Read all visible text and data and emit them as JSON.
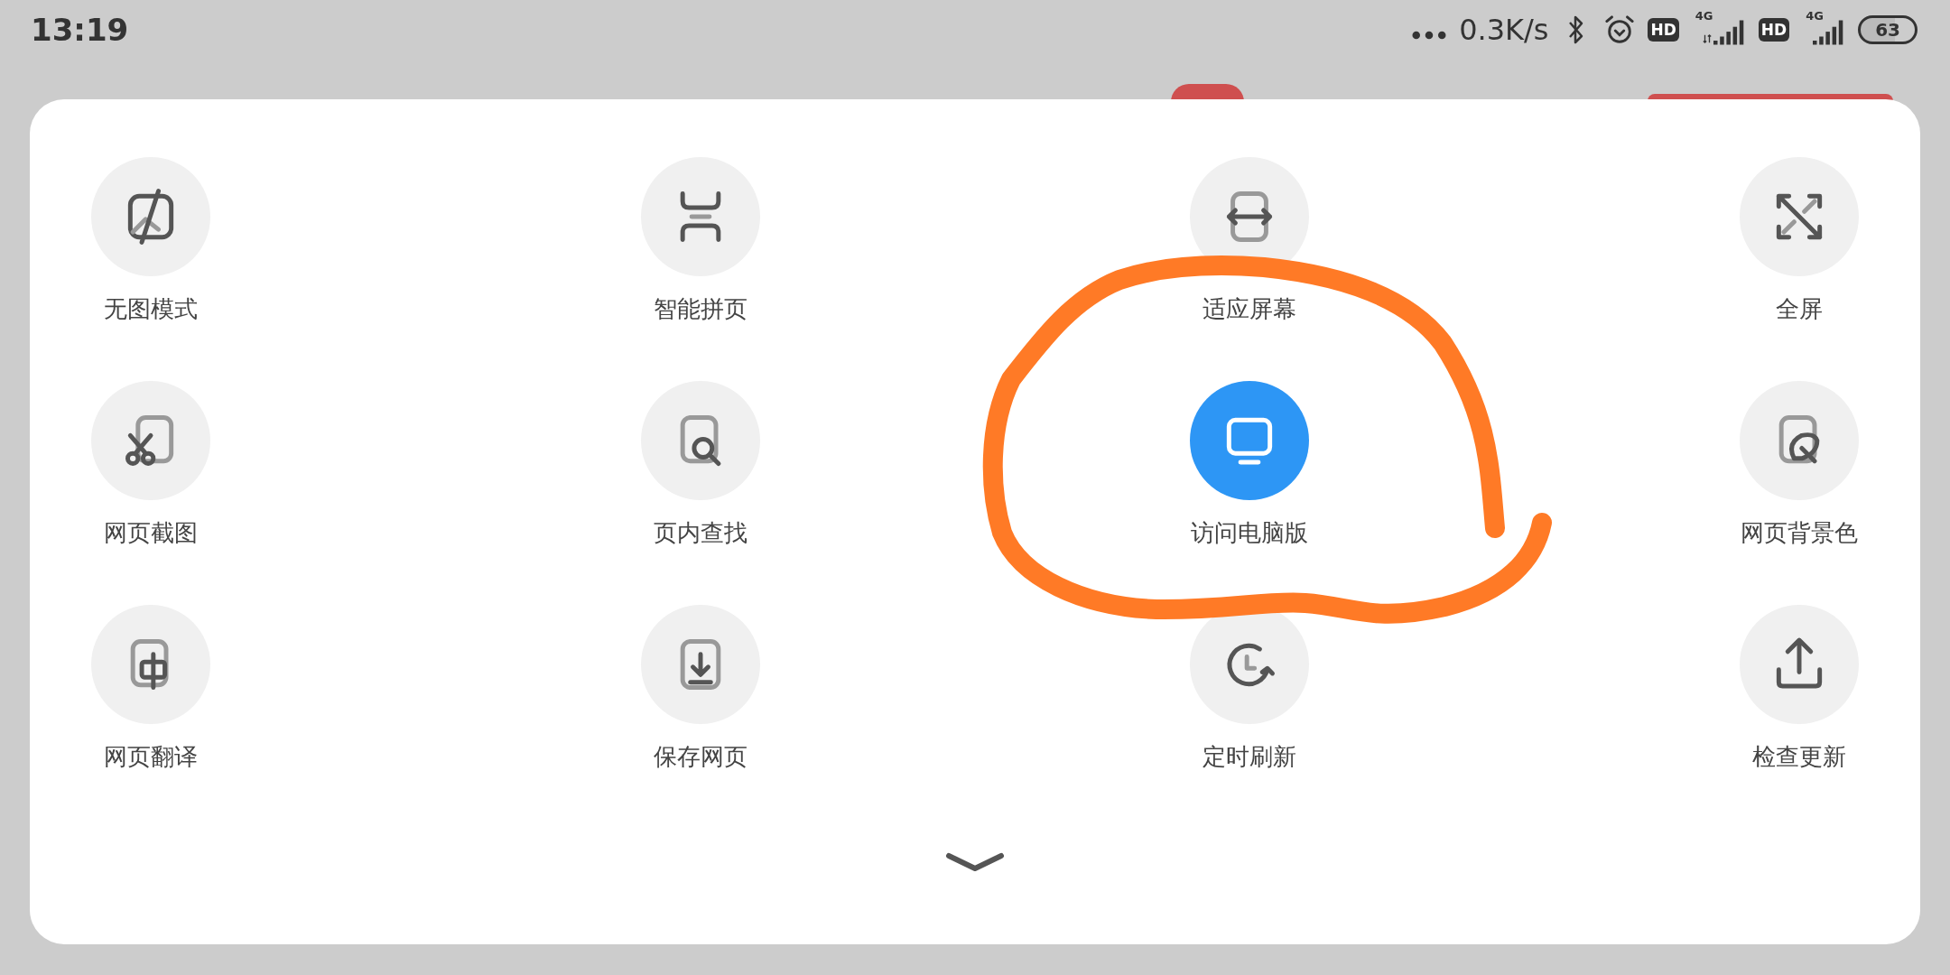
{
  "status_bar": {
    "time": "13:19",
    "net_speed": "0.3K/s",
    "sims": [
      {
        "hd": "HD",
        "network": "4G",
        "data_arrows": true
      },
      {
        "hd": "HD",
        "network": "4G",
        "data_arrows": false
      }
    ],
    "battery": "63"
  },
  "menu": {
    "items": [
      {
        "label": "无图模式",
        "on": false
      },
      {
        "label": "智能拼页",
        "on": false
      },
      {
        "label": "适应屏幕",
        "on": false
      },
      {
        "label": "全屏",
        "on": false
      },
      {
        "label": "网页截图",
        "on": false
      },
      {
        "label": "页内查找",
        "on": false
      },
      {
        "label": "访问电脑版",
        "on": true
      },
      {
        "label": "网页背景色",
        "on": false
      },
      {
        "label": "网页翻译",
        "on": false
      },
      {
        "label": "保存网页",
        "on": false
      },
      {
        "label": "定时刷新",
        "on": false
      },
      {
        "label": "检查更新",
        "on": false
      }
    ]
  }
}
